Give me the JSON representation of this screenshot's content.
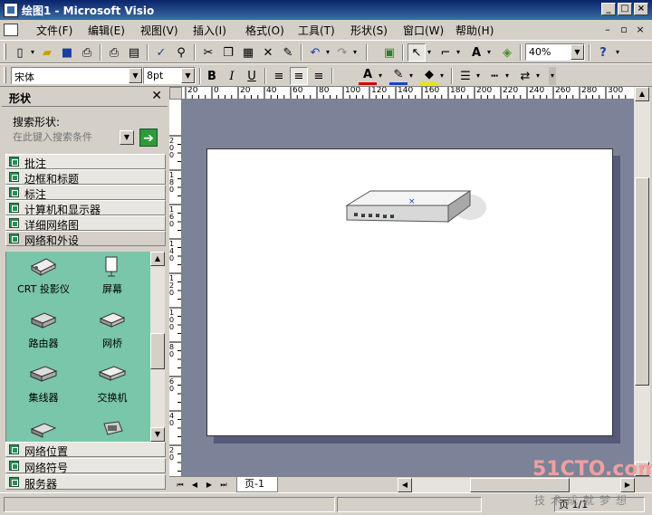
{
  "window": {
    "title": "绘图1 - Microsoft Visio",
    "controls": [
      "_",
      "□",
      "×"
    ]
  },
  "menu": [
    "文件(F)",
    "编辑(E)",
    "视图(V)",
    "插入(I)",
    "格式(O)",
    "工具(T)",
    "形状(S)",
    "窗口(W)",
    "帮助(H)"
  ],
  "mdi_controls": [
    "–",
    "▫",
    "×"
  ],
  "toolbar_standard": {
    "zoom": "40%",
    "icons": [
      "new-icon",
      "open-icon",
      "save-icon",
      "print-icon",
      "print-preview-icon",
      "spelling-icon",
      "research-icon",
      "cut-icon",
      "copy-icon",
      "delete-icon",
      "format-painter-icon",
      "undo-icon",
      "redo-icon",
      "shapes-window-icon",
      "pointer-tool-icon",
      "connector-tool-icon",
      "text-tool-icon",
      "fill-bucket-icon",
      "help-icon"
    ]
  },
  "toolbar_format": {
    "font": "宋体",
    "size": "8pt",
    "bold": "B",
    "italic": "I",
    "underline": "U"
  },
  "shapes_panel": {
    "title": "形状",
    "search_label": "搜索形状:",
    "search_placeholder": "在此键入搜索条件",
    "stencils_top": [
      "批注",
      "边框和标题",
      "标注",
      "计算机和显示器",
      "详细网络图",
      "网络和外设"
    ],
    "shapes": [
      "CRT 投影仪",
      "屏幕",
      "路由器",
      "网桥",
      "集线器",
      "交换机",
      "",
      ""
    ],
    "stencils_bottom": [
      "网络位置",
      "网络符号",
      "服务器"
    ]
  },
  "ruler_top": [
    "20",
    "0",
    "20",
    "40",
    "60",
    "80",
    "100",
    "120",
    "140",
    "160",
    "180",
    "200",
    "220",
    "240",
    "260",
    "280",
    "300"
  ],
  "ruler_left": [
    "200",
    "180",
    "160",
    "140",
    "120",
    "100",
    "80",
    "60",
    "40",
    "20"
  ],
  "page_tab": "页-1",
  "status": {
    "page": "页 1/1"
  },
  "watermark": {
    "brand": "51CTO.com",
    "slogan": "技术成就梦想"
  },
  "colors": {
    "stencil_bg": "#79c6aa",
    "canvas_bg": "#7c8398",
    "title_bar": "#0a246a"
  }
}
